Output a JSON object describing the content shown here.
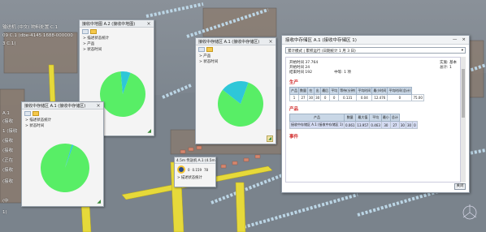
{
  "scene": {
    "overlay_lines": [
      "输送机 (中文) 物料处置 C.1",
      "09 C.1 (dbe-4145 1688-000000",
      "3 C.1)"
    ],
    "left_labels": [
      "A.1",
      "(接收",
      "1 (接收",
      "(接收",
      "(接收",
      "(正在",
      "(接收",
      "(接收",
      "(中",
      "1)"
    ]
  },
  "pane1": {
    "title": "接收中地图 A.2 (接收中地图)",
    "tree": [
      "> 描述状态统计",
      "> 产品",
      "> 状态时间"
    ],
    "pie": {
      "values": [
        0.93,
        0.07
      ],
      "colors": [
        "#58ee66",
        "#2ec7d8"
      ]
    }
  },
  "pane2": {
    "title": "接收中存储区 A.1 (接收中存储区)",
    "tree": [
      "> 描述状态统计",
      "> 状态时间"
    ],
    "pie": {
      "values": [
        0.99,
        0.01
      ],
      "colors": [
        "#58ee66",
        "#2ec7d8"
      ]
    }
  },
  "pane3": {
    "title": "接收中存储区 A.1 (接收中存储区)",
    "tree": [
      "> 产品",
      "> 状态时间"
    ],
    "pie": {
      "values": [
        0.8,
        0.2
      ],
      "colors": [
        "#58ee66",
        "#2ec7d8"
      ]
    }
  },
  "scanner": {
    "title": "4.5m 传送机 A.1 (4.5m)",
    "values": [
      "0",
      "0.159",
      "78"
    ],
    "tree": "> 描述状态统计"
  },
  "stats": {
    "title": "接收中存储区 A.1 (接收中存储区 1)",
    "dropdown": "累计模式 | 累积运行 (日期统计 1 月 3 日)",
    "meta": {
      "a": "开始时间 37.764",
      "b": "开始时间 24",
      "c": "结束时间 192",
      "d": "中等: 1 项",
      "e": "实施: 基本",
      "f": "总计: 1"
    },
    "section1": "生产",
    "section2": "产品",
    "section3": "事件",
    "table1": {
      "headers": [
        "产品",
        "数量",
        "在",
        "出",
        "最后",
        "平均",
        "等待(分钟)",
        "平均时间",
        "最小时间",
        "平均时间(总计)"
      ],
      "row": [
        "1",
        "27",
        "30",
        "30",
        "0",
        "0",
        "0.131",
        "0.04",
        "12.476",
        "0",
        "75.00"
      ]
    },
    "table2": {
      "headers": [
        "产品",
        "数量",
        "最大值",
        "平均",
        "最小",
        "总计"
      ],
      "row": [
        "接收中存储区 A.1 (接收中存储区 1)",
        "0.061",
        "13.957",
        "0.463",
        "30",
        "27",
        "30",
        "30",
        "0"
      ]
    },
    "close": "关闭"
  }
}
